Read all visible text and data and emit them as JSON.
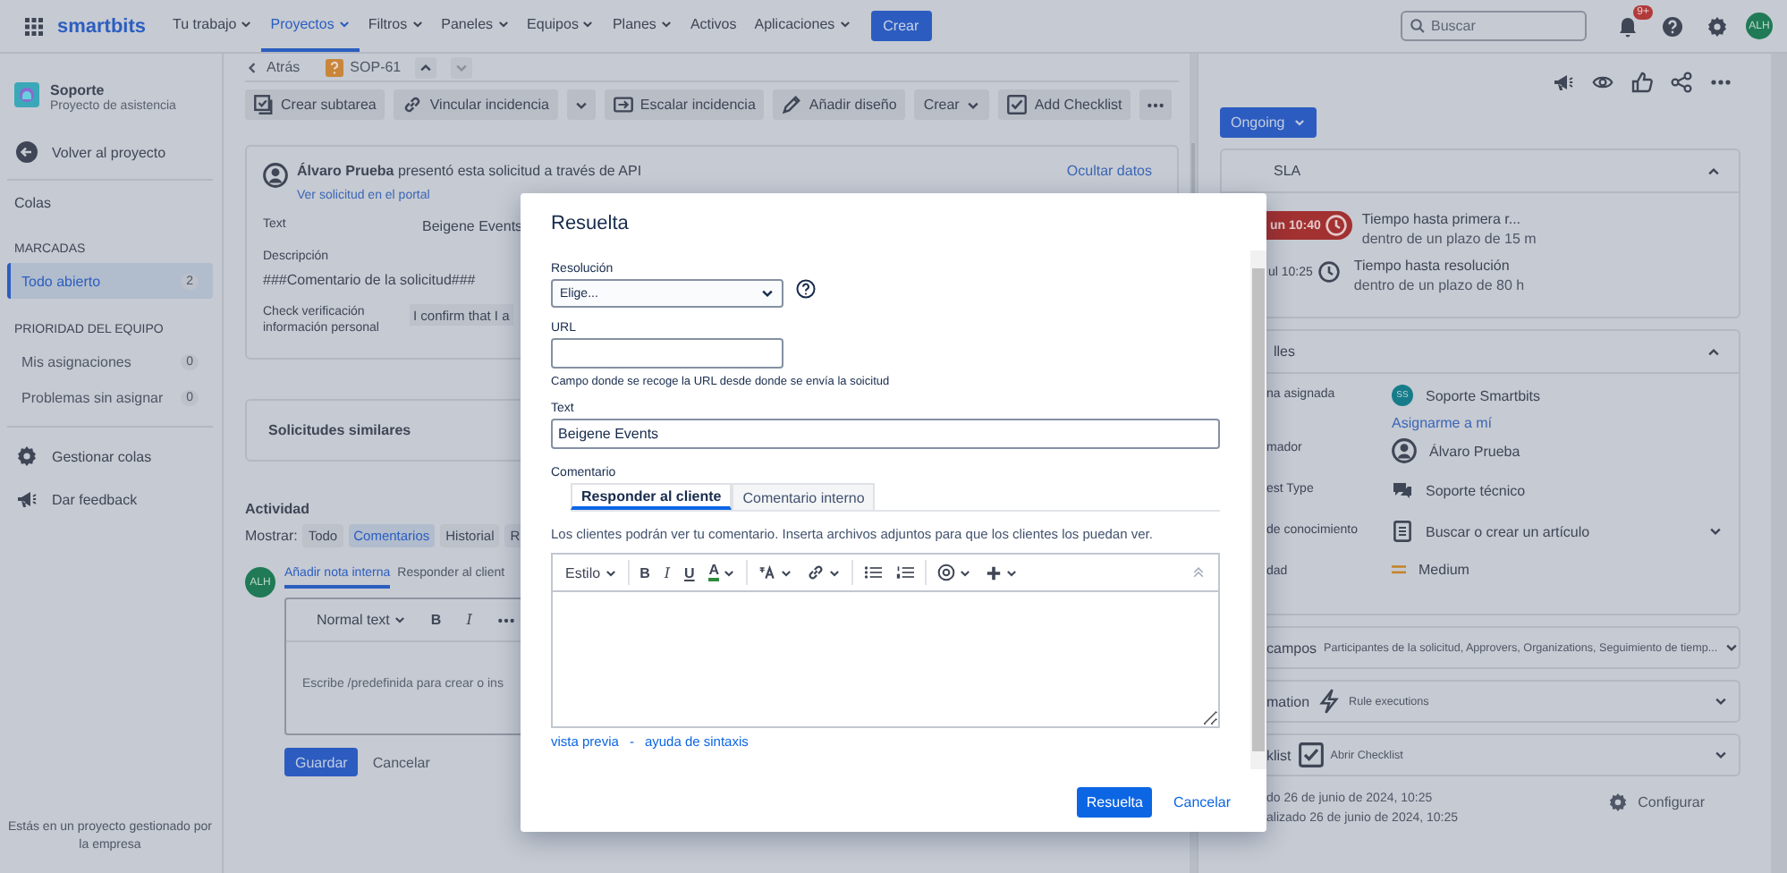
{
  "topbar": {
    "logo": "smartbits",
    "nav": [
      {
        "label": "Tu trabajo",
        "dropdown": true,
        "selected": false
      },
      {
        "label": "Proyectos",
        "dropdown": true,
        "selected": true
      },
      {
        "label": "Filtros",
        "dropdown": true,
        "selected": false
      },
      {
        "label": "Paneles",
        "dropdown": true,
        "selected": false
      },
      {
        "label": "Equipos",
        "dropdown": true,
        "selected": false
      },
      {
        "label": "Planes",
        "dropdown": true,
        "selected": false
      },
      {
        "label": "Activos",
        "dropdown": false,
        "selected": false
      },
      {
        "label": "Aplicaciones",
        "dropdown": true,
        "selected": false
      }
    ],
    "create": "Crear",
    "search": {
      "placeholder": "Buscar"
    },
    "notifications": "9+",
    "avatar": "ALH"
  },
  "sidebar": {
    "project": {
      "name": "Soporte",
      "subtitle": "Proyecto de asistencia"
    },
    "back": "Volver al proyecto",
    "title": "Colas",
    "groups": [
      {
        "heading": "MARCADAS",
        "items": [
          {
            "label": "Todo abierto",
            "count": "2",
            "selected": true
          }
        ]
      },
      {
        "heading": "PRIORIDAD DEL EQUIPO",
        "items": [
          {
            "label": "Mis asignaciones",
            "count": "0",
            "selected": false
          },
          {
            "label": "Problemas sin asignar",
            "count": "0",
            "selected": false
          }
        ]
      }
    ],
    "links": [
      {
        "kind": "gear",
        "label": "Gestionar colas"
      },
      {
        "kind": "megaphone",
        "label": "Dar feedback"
      }
    ],
    "footer": "Estás en un proyecto gestionado por la empresa"
  },
  "issue": {
    "back": "Atrás",
    "key": "SOP-61",
    "toolbar": [
      {
        "kind": "subtask",
        "label": "Crear subtarea"
      },
      {
        "kind": "link",
        "label": "Vincular incidencia"
      },
      {
        "kind": "caret"
      },
      {
        "kind": "escalate",
        "label": "Escalar incidencia"
      },
      {
        "kind": "design",
        "label": "Añadir diseño"
      },
      {
        "kind": "dropdown",
        "label": "Crear"
      },
      {
        "kind": "checklist",
        "label": "Add Checklist"
      },
      {
        "kind": "more"
      }
    ],
    "request": {
      "header": "**Álvaro Prueba** presentó esta solicitud a través de API",
      "portal": "Ver solicitud en el portal",
      "hide": "Ocultar datos",
      "fields": [
        {
          "kind": "inline",
          "label": "Text",
          "value": "Beigene Events"
        },
        {
          "kind": "block",
          "label": "Descripción",
          "value": "###Comentario de la solicitud###"
        },
        {
          "kind": "chip",
          "label": "Check verificación información personal",
          "value": "I confirm that I a"
        }
      ]
    },
    "similar": "Solicitudes similares",
    "activity": {
      "title": "Actividad",
      "show": "Mostrar:",
      "filters": [
        {
          "label": "Todo",
          "selected": false
        },
        {
          "label": "Comentarios",
          "selected": true
        },
        {
          "label": "Historial",
          "selected": false
        },
        {
          "label": "R",
          "selected": false
        }
      ],
      "avatar": "ALH",
      "tabs": [
        {
          "label": "Añadir nota interna",
          "selected": true
        },
        {
          "label": "Responder al client",
          "selected": false
        }
      ],
      "editor": {
        "tools": [
          {
            "kind": "style",
            "label": "Normal text"
          },
          {
            "kind": "bold",
            "label": "B"
          },
          {
            "kind": "italic",
            "label": "I"
          },
          {
            "kind": "more"
          }
        ],
        "placeholder": "Escribe /predefinida para crear o ins"
      },
      "save": "Guardar",
      "cancel": "Cancelar"
    }
  },
  "modal": {
    "title": "Resuelta",
    "resolution": {
      "label": "Resolución",
      "value": "Elige..."
    },
    "url": {
      "label": "URL",
      "help": "Campo donde se recoge la URL desde donde se envía la soicitud"
    },
    "text": {
      "label": "Text",
      "value": "Beigene Events"
    },
    "comment": {
      "label": "Comentario",
      "tabs": [
        {
          "label": "Responder al cliente",
          "selected": true
        },
        {
          "label": "Comentario interno",
          "selected": false
        }
      ],
      "note": "Los clientes podrán ver tu comentario. Inserta archivos adjuntos para que los clientes los puedan ver.",
      "tools": [
        {
          "kind": "style",
          "label": "Estilo"
        },
        {
          "kind": "bold",
          "label": "B"
        },
        {
          "kind": "italic",
          "label": "I"
        },
        {
          "kind": "underline",
          "label": "U"
        },
        {
          "kind": "color",
          "label": "A"
        },
        {
          "kind": "size"
        },
        {
          "kind": "link"
        },
        {
          "kind": "bullets"
        },
        {
          "kind": "numbers"
        },
        {
          "kind": "mention"
        },
        {
          "kind": "plus"
        }
      ],
      "links": [
        "vista previa",
        "ayuda de sintaxis"
      ],
      "separator": "-"
    },
    "submit": "Resuelta",
    "cancel": "Cancelar"
  },
  "panel": {
    "status": "Ongoing",
    "sla": {
      "title": "SLA",
      "items": [
        {
          "time": "un 10:40",
          "breached": true,
          "name": "Tiempo hasta primera r...",
          "remaining": "dentro de un plazo de 15 m"
        },
        {
          "time": "ul 10:25",
          "breached": false,
          "name": "Tiempo hasta resolución",
          "remaining": "dentro de un plazo de 80 h"
        }
      ]
    },
    "details": {
      "title": "lles",
      "fields": [
        {
          "kind": "team",
          "label": "na asignada",
          "avatar": "SS",
          "value": "Soporte Smartbits",
          "link": "Asignarme a mí"
        },
        {
          "kind": "person",
          "label": "mador",
          "value": "Álvaro Prueba"
        },
        {
          "kind": "type",
          "label": "est Type",
          "value": "Soporte técnico"
        },
        {
          "kind": "article",
          "label": "de conocimiento",
          "value": "Buscar o crear un artículo"
        },
        {
          "kind": "priority",
          "label": "dad",
          "value": "Medium"
        }
      ]
    },
    "sections": [
      {
        "kind": "fields",
        "title": "campos",
        "detail": "Participantes de la solicitud, Approvers, Organizations, Seguimiento de tiemp..."
      },
      {
        "kind": "automation",
        "title": "mation",
        "detail": "Rule executions"
      },
      {
        "kind": "checklist",
        "title": "klist",
        "detail": "Abrir Checklist"
      }
    ],
    "created": "do 26 de junio de 2024, 10:25",
    "updated": "alizado 26 de junio de 2024, 10:25",
    "configure": "Configurar"
  }
}
